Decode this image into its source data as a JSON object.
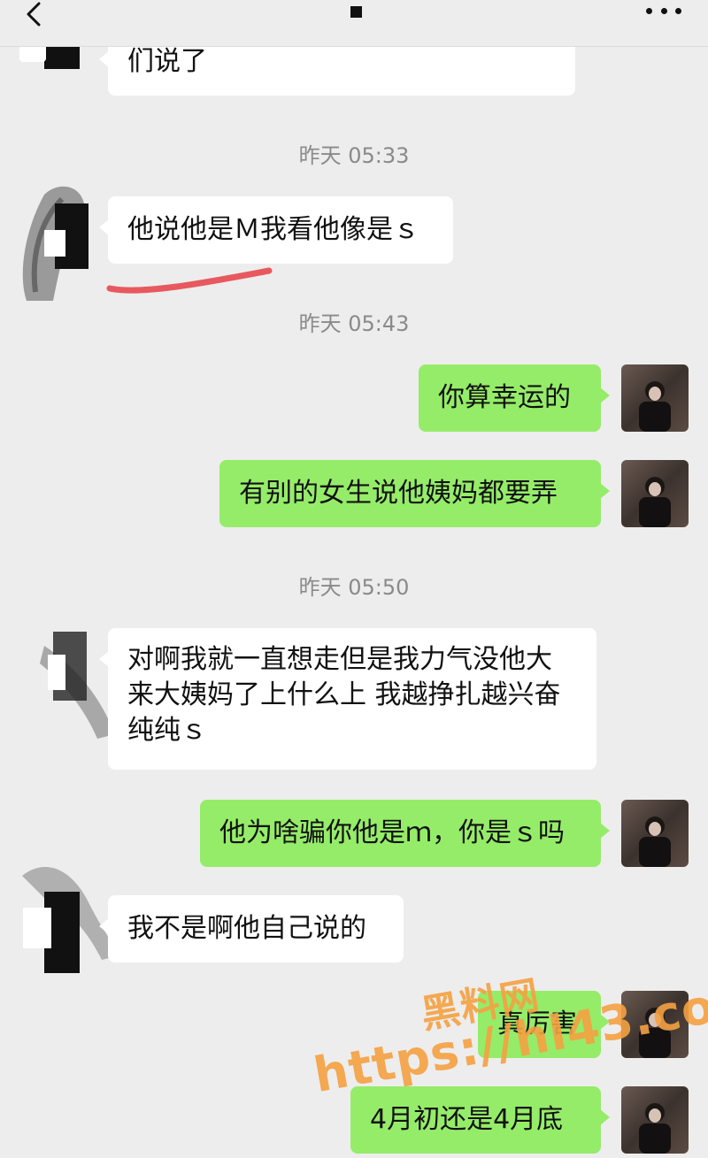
{
  "header": {
    "back_icon": "chevron-left-icon",
    "more_icon": "more-dots-icon"
  },
  "messages": [
    {
      "side": "in",
      "text": "们说了"
    },
    {
      "type": "time",
      "text": "昨天 05:33"
    },
    {
      "side": "in",
      "text": "他说他是Ｍ我看他像是ｓ"
    },
    {
      "type": "time",
      "text": "昨天 05:43"
    },
    {
      "side": "out",
      "text": "你算幸运的"
    },
    {
      "side": "out",
      "text": "有别的女生说他姨妈都要弄"
    },
    {
      "type": "time",
      "text": "昨天 05:50"
    },
    {
      "side": "in",
      "text": "对啊我就一直想走但是我力气没他大  来大姨妈了上什么上 我越挣扎越兴奋纯纯ｓ"
    },
    {
      "side": "out",
      "text": "他为啥骗你他是ｍ，你是ｓ吗"
    },
    {
      "side": "in",
      "text": "我不是啊他自己说的"
    },
    {
      "side": "out",
      "text": "真厉害"
    },
    {
      "side": "out",
      "text": "4月初还是4月底"
    }
  ],
  "watermark": {
    "line1": "黑料网",
    "line2": "https://hl43.co"
  },
  "colors": {
    "background": "#ededed",
    "incoming_bubble": "#ffffff",
    "outgoing_bubble": "#95ec69",
    "timestamp": "#8a8a8a",
    "underline": "#e8585f",
    "watermark": "#f5a142"
  }
}
